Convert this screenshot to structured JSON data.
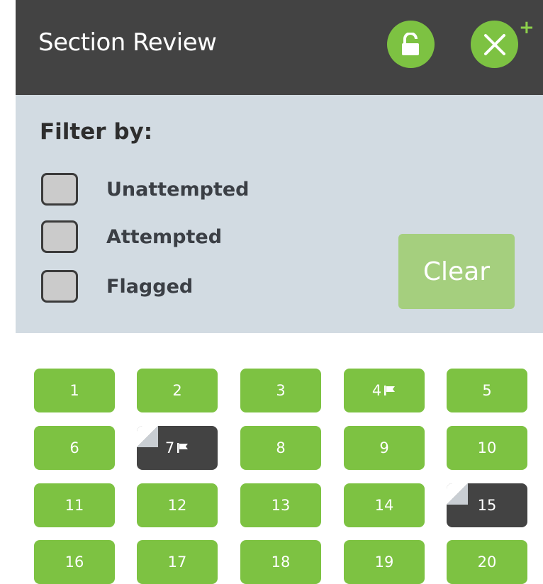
{
  "header": {
    "title": "Section Review",
    "lock_icon": "unlock-icon",
    "close_icon": "close-icon",
    "colors": {
      "bar": "#434343",
      "accent": "#7dc242"
    }
  },
  "filter": {
    "title": "Filter by:",
    "options": [
      {
        "label": "Unattempted",
        "checked": false
      },
      {
        "label": "Attempted",
        "checked": false
      },
      {
        "label": "Flagged",
        "checked": false
      }
    ],
    "clear_label": "Clear"
  },
  "questions": [
    {
      "label": "1",
      "state": "answered",
      "flagged": false
    },
    {
      "label": "2",
      "state": "answered",
      "flagged": false
    },
    {
      "label": "3",
      "state": "answered",
      "flagged": false
    },
    {
      "label": "4",
      "state": "answered",
      "flagged": true
    },
    {
      "label": "5",
      "state": "answered",
      "flagged": false
    },
    {
      "label": "6",
      "state": "answered",
      "flagged": false
    },
    {
      "label": "7",
      "state": "unattempted",
      "flagged": true
    },
    {
      "label": "8",
      "state": "answered",
      "flagged": false
    },
    {
      "label": "9",
      "state": "answered",
      "flagged": false
    },
    {
      "label": "10",
      "state": "answered",
      "flagged": false
    },
    {
      "label": "11",
      "state": "answered",
      "flagged": false
    },
    {
      "label": "12",
      "state": "answered",
      "flagged": false
    },
    {
      "label": "13",
      "state": "answered",
      "flagged": false
    },
    {
      "label": "14",
      "state": "answered",
      "flagged": false
    },
    {
      "label": "15",
      "state": "unattempted",
      "flagged": false
    },
    {
      "label": "16",
      "state": "answered",
      "flagged": false
    },
    {
      "label": "17",
      "state": "answered",
      "flagged": false
    },
    {
      "label": "18",
      "state": "answered",
      "flagged": false
    },
    {
      "label": "19",
      "state": "answered",
      "flagged": false
    },
    {
      "label": "20",
      "state": "answered",
      "flagged": false
    }
  ]
}
